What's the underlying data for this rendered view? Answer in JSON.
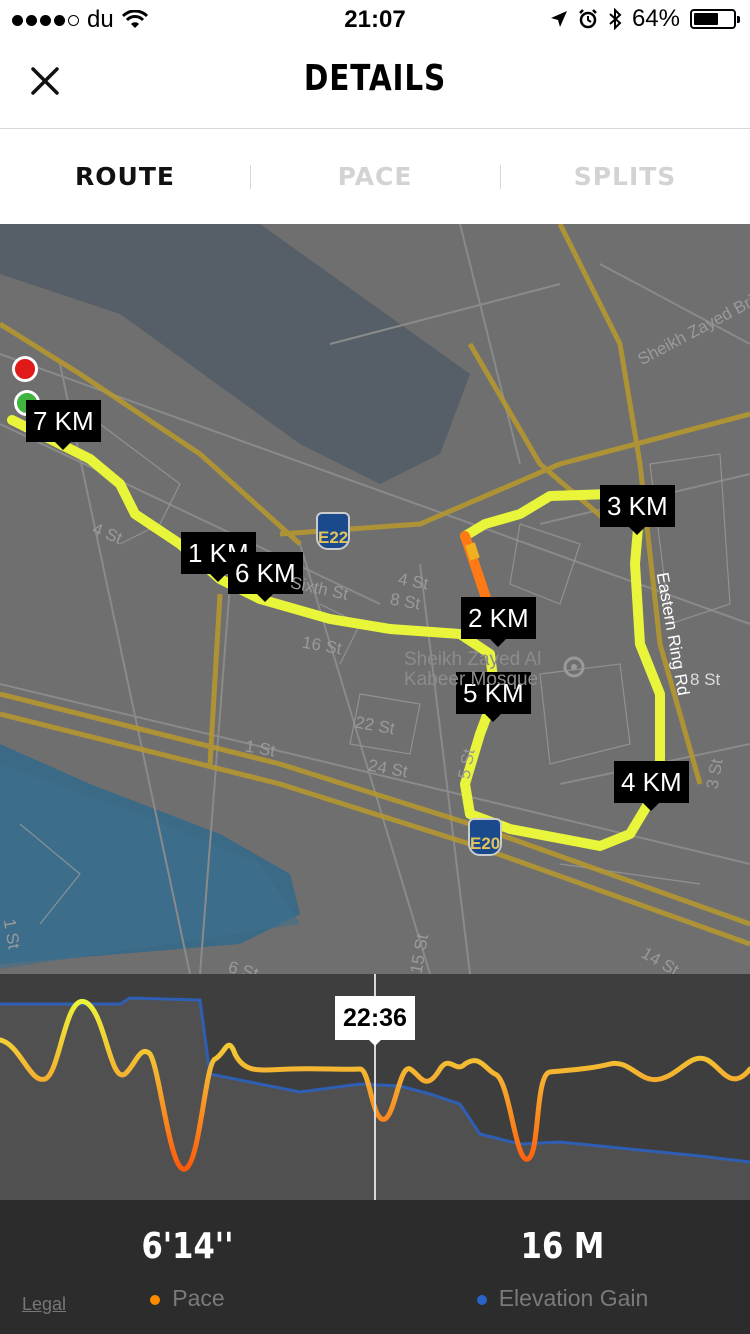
{
  "status_bar": {
    "carrier": "du",
    "time": "21:07",
    "battery": "64%",
    "battery_level": 0.64
  },
  "header": {
    "title": "DETAILS",
    "close_icon": "close-icon"
  },
  "tabs": [
    {
      "label": "ROUTE",
      "active": true
    },
    {
      "label": "PACE",
      "active": false
    },
    {
      "label": "SPLITS",
      "active": false
    }
  ],
  "map": {
    "km_markers": [
      "7 KM",
      "1 KM",
      "6 KM",
      "2 KM",
      "3 KM",
      "5 KM",
      "4 KM"
    ],
    "pois": [
      "Sheikh Zayed Al Kabeer Mosque"
    ],
    "streets": [
      "Sheikh Zayed Bridge",
      "Eastern Ring Rd",
      "4 St",
      "Sixth St",
      "4 St",
      "8 St",
      "16 St",
      "22 St",
      "1 St",
      "24 St",
      "5 St",
      "8 St",
      "3 St",
      "6 St",
      "15 St",
      "14 St",
      "1 St",
      "3 St"
    ],
    "highway_shields": [
      "E22",
      "E20"
    ],
    "route_color": "#e8f53a",
    "start_color": "#3fb43f",
    "end_color": "#e01919",
    "legal": "Legal"
  },
  "chart": {
    "time_label": "22:36",
    "pace_color": "#ff8c00",
    "elevation_color": "#2a63c8"
  },
  "stats": {
    "pace_value": "6'14''",
    "pace_label": "Pace",
    "elevation_value": "16 M",
    "elevation_label": "Elevation Gain"
  }
}
